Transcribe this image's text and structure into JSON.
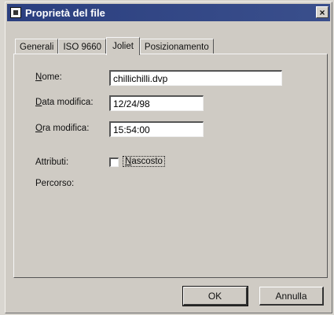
{
  "window": {
    "title": "Proprietà del file",
    "close_label": "×"
  },
  "tabs": [
    {
      "label": "Generali",
      "active": false
    },
    {
      "label": "ISO 9660",
      "active": false
    },
    {
      "label": "Joliet",
      "active": true
    },
    {
      "label": "Posizionamento",
      "active": false
    }
  ],
  "form": {
    "name_label_key": "N",
    "name_label_rest": "ome:",
    "name_value": "chillichilli.dvp",
    "date_label_key": "D",
    "date_label_rest": "ata modifica:",
    "date_value": "12/24/98",
    "time_label_key": "O",
    "time_label_rest": "ra modifica:",
    "time_value": "15:54:00",
    "attributes_label": "Attributi:",
    "hidden_label_key": "N",
    "hidden_label_rest": "ascosto",
    "hidden_checked": false,
    "path_label": "Percorso:"
  },
  "buttons": {
    "ok": "OK",
    "cancel": "Annulla"
  }
}
